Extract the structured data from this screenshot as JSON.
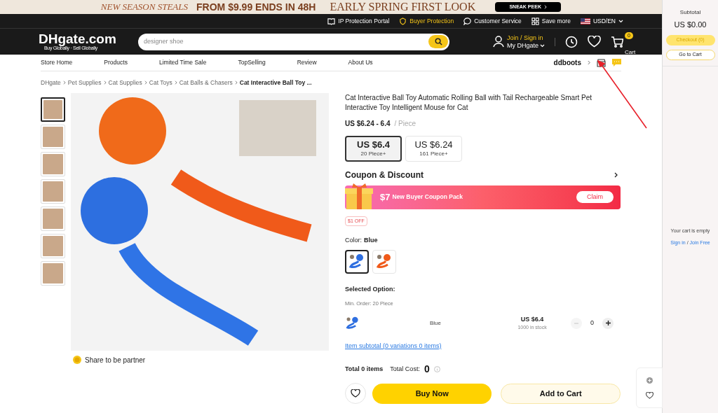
{
  "promo_banner": {
    "left_text": "NEW SEASON STEALS",
    "middle_text": "FROM $9.99 ENDS IN 48H",
    "right_text": "EARLY SPRING FIRST LOOK",
    "button": "SNEAK PEEK"
  },
  "top_bar": {
    "links": [
      {
        "label": "IP Protection Portal",
        "kind": "book",
        "highlight": false
      },
      {
        "label": "Buyer Protection",
        "kind": "shield",
        "highlight": true
      },
      {
        "label": "Customer Service",
        "kind": "chat",
        "highlight": false
      },
      {
        "label": "Save more",
        "kind": "grid",
        "highlight": false
      }
    ],
    "locale": "USD/EN"
  },
  "header": {
    "logo": "DHgate.com",
    "logo_tagline": "Buy Globally · Sell Globally",
    "search_placeholder": "designer shoe",
    "join": "Join / Sign in",
    "account": "My DHgate",
    "cart_count": "0",
    "cart_label": "Cart"
  },
  "store_nav": {
    "items": [
      "Store Home",
      "Products",
      "Limited Time Sale",
      "TopSelling",
      "Review",
      "About Us"
    ],
    "store_name": "ddboots"
  },
  "breadcrumb": [
    "DHgate",
    "Pet Supplies",
    "Cat Supplies",
    "Cat Toys",
    "Cat Balls & Chasers",
    "Cat Interactive Ball Toy ..."
  ],
  "gallery": {
    "thumbnails": [
      {
        "selected": true
      },
      {
        "selected": false
      },
      {
        "selected": false
      },
      {
        "selected": false
      },
      {
        "selected": false
      },
      {
        "selected": false
      },
      {
        "selected": false
      }
    ],
    "share": "Share to be partner"
  },
  "product": {
    "title": "Cat Interactive Ball Toy Automatic Rolling Ball with Tail Rechargeable Smart Pet Interactive Toy Intelligent Mouse for Cat",
    "price_range": "US $6.24 - 6.4",
    "unit": "/ Piece",
    "price_tiers": [
      {
        "price": "US $6.4",
        "quantity": "20 Piece+",
        "selected": true
      },
      {
        "price": "US $6.24",
        "quantity": "161 Piece+",
        "selected": false
      }
    ],
    "coupon_heading": "Coupon & Discount",
    "coupon_amount": "$7",
    "coupon_text": "New Buyer Coupon Pack",
    "claim": "Claim",
    "discount_tag": "$1 OFF",
    "color_label": "Color:",
    "color_value": "Blue",
    "colors": [
      {
        "color": "#2f6fe0",
        "selected": true
      },
      {
        "color": "#f05a1a",
        "selected": false
      }
    ],
    "selected_option_heading": "Selected Option:",
    "min_order": "Min. Order: 20 Piece",
    "option": {
      "name": "Blue",
      "price": "US $6.4",
      "stock": "1000 in stock",
      "quantity": "0",
      "decrease_disabled": true
    },
    "subtotal_link": "Item subtotal (0 variations 0 items)",
    "total_items": "Total 0 items",
    "total_cost_label": "Total Cost:",
    "total_cost": "0",
    "buy_now": "Buy Now",
    "add_to_cart": "Add to Cart"
  },
  "cart_sidebar": {
    "subtotal_label": "Subtotal",
    "subtotal": "US $0.00",
    "checkout": "Checkout (0)",
    "checkout_disabled": true,
    "go_to_cart": "Go to Cart",
    "empty_text": "Your cart is empty",
    "sign_in": "Sign in",
    "join_free": "Join Free",
    "separator": "/"
  }
}
